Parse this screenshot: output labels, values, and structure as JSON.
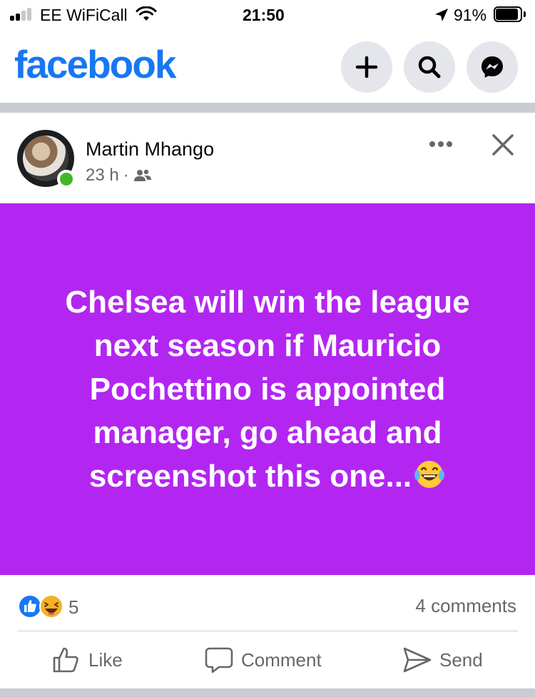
{
  "status_bar": {
    "carrier": "EE WiFiCall",
    "time": "21:50",
    "battery": "91%",
    "battery_level": 0.91,
    "signal_bars_filled": 2,
    "signal_bars_total": 4
  },
  "header": {
    "logo": "facebook",
    "brand_color": "#1877f2",
    "buttons": [
      "plus-icon",
      "search-icon",
      "messenger-icon"
    ]
  },
  "post": {
    "author": "Martin Mhango",
    "time": "23 h",
    "separator": "·",
    "audience_icon": "friends-icon",
    "text": "Chelsea will win the league next season if Mauricio Pochettino is appointed manager, go ahead and screenshot this one...",
    "background_color": "#b326f2",
    "emoji": "laughing-tears-emoji"
  },
  "reactions": {
    "count": "5",
    "types": [
      "like",
      "haha"
    ],
    "comments": "4 comments"
  },
  "actions": {
    "like": "Like",
    "comment": "Comment",
    "send": "Send"
  }
}
